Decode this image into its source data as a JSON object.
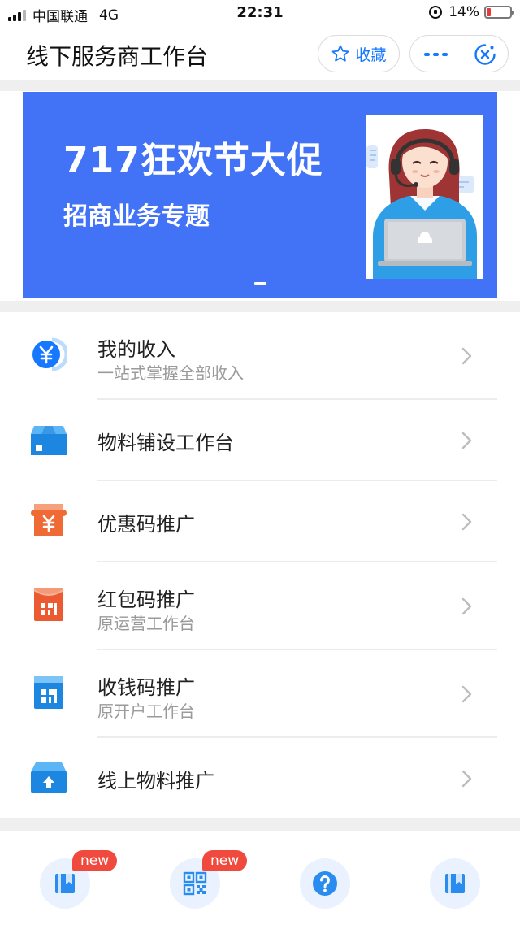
{
  "status_bar": {
    "carrier": "中国联通",
    "network": "4G",
    "time": "22:31",
    "battery": "14%"
  },
  "nav": {
    "title": "线下服务商工作台",
    "favorite_label": "收藏",
    "accent_color": "#1677ff"
  },
  "banner": {
    "title": "717狂欢节大促",
    "subtitle": "招商业务专题",
    "background": "#4273f7"
  },
  "menu": {
    "items": [
      {
        "title": "我的收入",
        "subtitle": "一站式掌握全部收入",
        "icon": "yuan-coin-icon"
      },
      {
        "title": "物料铺设工作台",
        "subtitle": "",
        "icon": "box-icon"
      },
      {
        "title": "优惠码推广",
        "subtitle": "",
        "icon": "coupon-ticket-icon"
      },
      {
        "title": "红包码推广",
        "subtitle": "原运营工作台",
        "icon": "red-packet-code-icon"
      },
      {
        "title": "收钱码推广",
        "subtitle": "原开户工作台",
        "icon": "payment-code-icon"
      },
      {
        "title": "线上物料推广",
        "subtitle": "",
        "icon": "upload-box-icon"
      }
    ]
  },
  "bottom": {
    "items": [
      {
        "badge": "new",
        "label": "",
        "icon": "bookmark-book-icon"
      },
      {
        "badge": "new",
        "label": "",
        "icon": "qr-code-icon"
      },
      {
        "badge": "",
        "label": "",
        "icon": "help-icon"
      },
      {
        "badge": "",
        "label": "",
        "icon": "bookmark-book-icon"
      }
    ]
  }
}
